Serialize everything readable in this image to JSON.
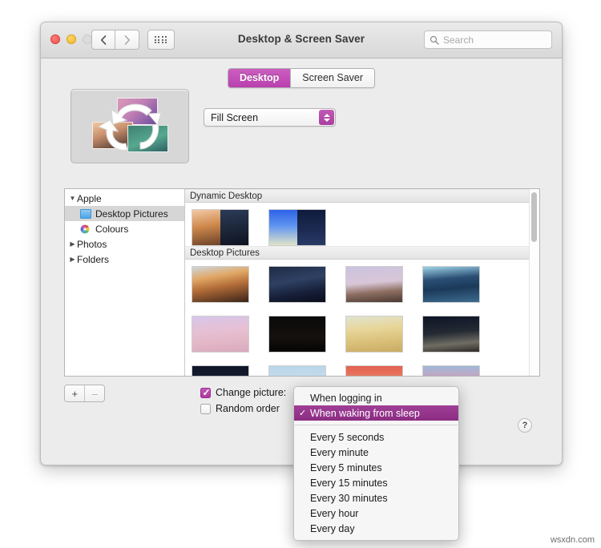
{
  "window": {
    "title": "Desktop & Screen Saver",
    "traffic_lights": [
      "close",
      "minimize",
      "zoom-disabled"
    ],
    "nav": {
      "back": "‹",
      "forward": "›",
      "grid": "grid-icon"
    },
    "search": {
      "placeholder": "Search",
      "value": ""
    }
  },
  "tabs": [
    {
      "label": "Desktop",
      "active": true
    },
    {
      "label": "Screen Saver",
      "active": false
    }
  ],
  "preview": {
    "name": "desktop-picture-rotation-preview"
  },
  "fit_popup": {
    "value": "Fill Screen"
  },
  "sidebar": [
    {
      "label": "Apple",
      "disclosure": "▼",
      "icon": "none",
      "indent": false,
      "selected": false
    },
    {
      "label": "Desktop Pictures",
      "disclosure": "",
      "icon": "folder-icon",
      "indent": true,
      "selected": true
    },
    {
      "label": "Colours",
      "disclosure": "",
      "icon": "colour-wheel-icon",
      "indent": true,
      "selected": false
    },
    {
      "label": "Photos",
      "disclosure": "▶",
      "icon": "none",
      "indent": false,
      "selected": false
    },
    {
      "label": "Folders",
      "disclosure": "▶",
      "icon": "none",
      "indent": false,
      "selected": false
    }
  ],
  "sections": [
    {
      "header": "Dynamic Desktop",
      "tiles": [
        {
          "name": "mojave-dynamic",
          "left": "linear-gradient(170deg,#f3c9a6 0%,#d08a4e 45%,#6b4226 100%)",
          "right": "linear-gradient(170deg,#2b3b57 0%,#1b2436 60%,#0d1220 100%)"
        },
        {
          "name": "solar-gradients-dynamic",
          "left": "linear-gradient(180deg,#2e63e8 0%,#5f94f0 45%,#dfe3c9 100%)",
          "right": "linear-gradient(180deg,#0f1b3c 0%,#1c2a52 55%,#283a66 100%)"
        }
      ]
    },
    {
      "header": "Desktop Pictures",
      "rows": [
        [
          {
            "name": "mojave-day",
            "fill": "linear-gradient(170deg,#cfd6dd 0%,#e0a765 30%,#b36d38 55%,#3a2419 100%)"
          },
          {
            "name": "mojave-night",
            "fill": "linear-gradient(170deg,#1e2b45 0%,#2f4163 40%,#17203a 70%,#0a0e1a 100%)"
          },
          {
            "name": "catalina-rock",
            "fill": "linear-gradient(175deg,#ccc3e0 0%,#d8c6d6 45%,#8e6f62 70%,#4b3a33 100%)"
          },
          {
            "name": "lake-blue",
            "fill": "linear-gradient(175deg,#9fd4e8 0%,#2a4e74 35%,#1b3a5a 60%,#3d6b8f 100%)"
          }
        ],
        [
          {
            "name": "pink-lake-rock",
            "fill": "linear-gradient(175deg,#d7c6ea 0%,#e6c0d4 40%,#e3b7c6 70%,#d8a9bd 100%)"
          },
          {
            "name": "dark-rock-formation",
            "fill": "linear-gradient(180deg,#0a0a0a 0%,#15110f 60%,#050505 100%)"
          },
          {
            "name": "sand-dunes-light",
            "fill": "linear-gradient(175deg,#dfe3cf 0%,#e8d69a 35%,#d9bf78 70%,#c9ab63 100%)"
          },
          {
            "name": "sand-dune-dark",
            "fill": "linear-gradient(175deg,#0d1526 0%,#232a33 45%,#6f6d64 75%,#2c2a26 100%)"
          }
        ],
        [
          {
            "name": "dark-desert-night",
            "fill": "linear-gradient(180deg,#0e1526 0%,#1a2336 55%,#090d16 100%)"
          },
          {
            "name": "pale-blue-sky",
            "fill": "linear-gradient(180deg,#b9d6ea 0%,#cfe0ec 60%,#e4ebf1 100%)"
          },
          {
            "name": "red-sunset",
            "fill": "linear-gradient(180deg,#e4604f 0%,#e98a6f 50%,#f2b79b 100%)"
          },
          {
            "name": "pink-sunset-clouds",
            "fill": "linear-gradient(180deg,#9fb8d8 0%,#d89cb4 45%,#e8b3c2 100%)"
          }
        ]
      ]
    }
  ],
  "bottom": {
    "add_label": "+",
    "remove_label": "–",
    "change_picture": {
      "label": "Change picture:",
      "checked": true
    },
    "random_order": {
      "label": "Random order",
      "checked": false
    },
    "help_label": "?"
  },
  "menu": {
    "items": [
      {
        "label": "When logging in",
        "selected": false,
        "separator_after": false
      },
      {
        "label": "When waking from sleep",
        "selected": true,
        "separator_after": true
      },
      {
        "label": "Every 5 seconds",
        "selected": false,
        "separator_after": false
      },
      {
        "label": "Every minute",
        "selected": false,
        "separator_after": false
      },
      {
        "label": "Every 5 minutes",
        "selected": false,
        "separator_after": false
      },
      {
        "label": "Every 15 minutes",
        "selected": false,
        "separator_after": false
      },
      {
        "label": "Every 30 minutes",
        "selected": false,
        "separator_after": false
      },
      {
        "label": "Every hour",
        "selected": false,
        "separator_after": false
      },
      {
        "label": "Every day",
        "selected": false,
        "separator_after": false
      }
    ],
    "checkmark": "✓"
  },
  "watermark": "wsxdn.com",
  "colors": {
    "accent": "#b93fae",
    "menu_highlight": "#8b2d83",
    "window_bg": "#ececec"
  }
}
